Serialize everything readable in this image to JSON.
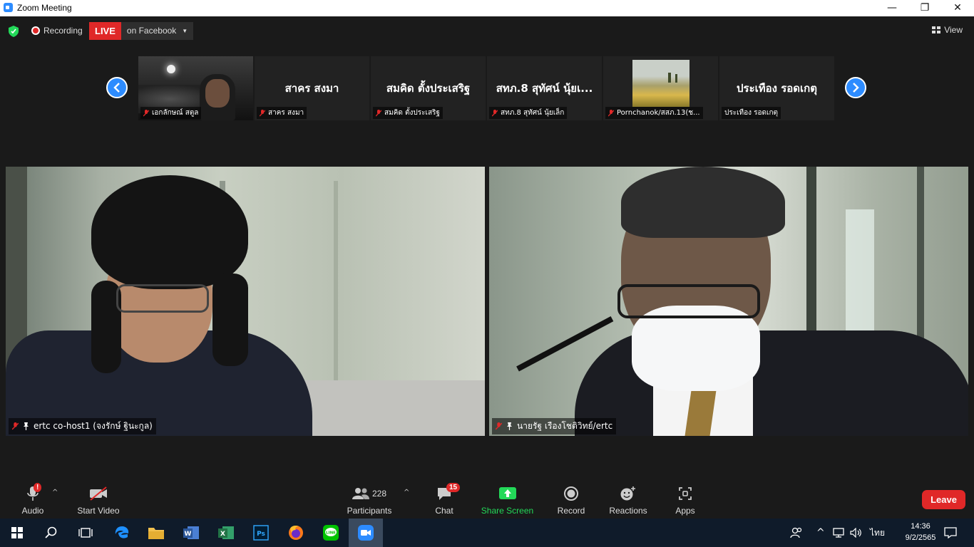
{
  "window": {
    "title": "Zoom Meeting",
    "minimize": "—",
    "maximize": "❐",
    "close": "✕"
  },
  "status": {
    "recording_label": "Recording",
    "live_badge": "LIVE",
    "live_destination": "on Facebook",
    "view_label": "View"
  },
  "thumbnails": [
    {
      "big": "",
      "caption": "เอกลักษณ์ สตูล"
    },
    {
      "big": "สาคร สงมา",
      "caption": "สาคร สงมา"
    },
    {
      "big": "สมคิด ตั้งประเสริฐ",
      "caption": "สมคิด ตั้งประเสริฐ"
    },
    {
      "big": "สทภ.8 สุทัศน์ นุ้ยเ...",
      "caption": "สทภ.8 สุทัศน์ นุ้ยเล็ก"
    },
    {
      "big": "",
      "caption": "Pornchanok/สสภ.13(ช..."
    },
    {
      "big": "ประเทือง  รอดเกตุ",
      "caption": "ประเทือง  รอดเกตุ"
    }
  ],
  "main_videos": [
    {
      "name": "ertc co-host1 (จงรักษ์ ฐินะกูล)"
    },
    {
      "name": "นายรัฐ เรืองโชติวิทย์/ertc"
    }
  ],
  "toolbar": {
    "audio": "Audio",
    "audio_alert": "!",
    "start_video": "Start Video",
    "participants": "Participants",
    "participants_count": "228",
    "chat": "Chat",
    "chat_count": "15",
    "share_screen": "Share Screen",
    "record": "Record",
    "reactions": "Reactions",
    "apps": "Apps",
    "leave": "Leave"
  },
  "colors": {
    "zoom_blue": "#2d8cff",
    "live_red": "#e02828",
    "share_green": "#23d959"
  },
  "taskbar": {
    "apps": [
      "windows-start",
      "search",
      "task-view",
      "edge",
      "file-explorer",
      "word",
      "excel",
      "photoshop",
      "firefox",
      "line",
      "zoom"
    ],
    "language": "ไทย",
    "time": "14:36",
    "date": "9/2/2565"
  }
}
